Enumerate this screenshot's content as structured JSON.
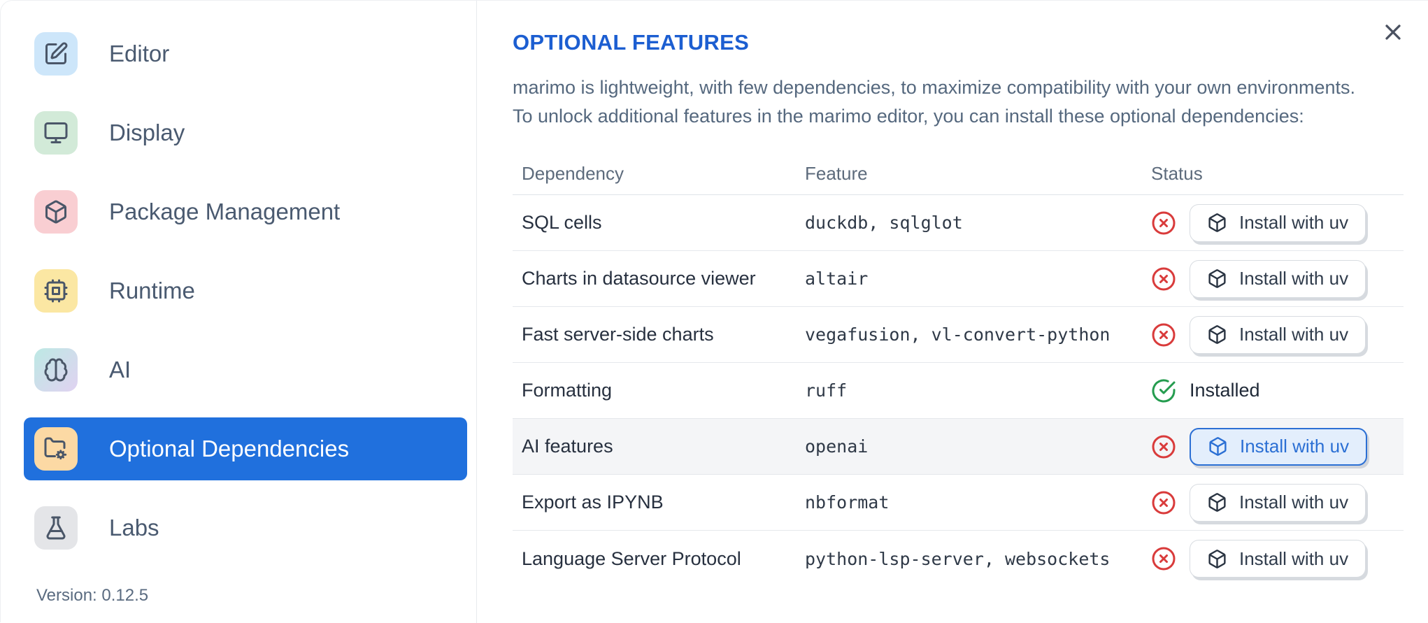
{
  "app": {
    "close_icon": "x-icon"
  },
  "sidebar": {
    "items": [
      {
        "label": "Editor",
        "icon": "edit-icon",
        "icon_bg": "#cde6fa",
        "selected": false
      },
      {
        "label": "Display",
        "icon": "monitor-icon",
        "icon_bg": "#d2ead8",
        "selected": false
      },
      {
        "label": "Package Management",
        "icon": "package-icon",
        "icon_bg": "#f9ced2",
        "selected": false
      },
      {
        "label": "Runtime",
        "icon": "cpu-icon",
        "icon_bg": "#fbe7a3",
        "selected": false
      },
      {
        "label": "AI",
        "icon": "brain-icon",
        "icon_bg": "linear-gradient(135deg,#bde9e4,#e0d2f1)",
        "selected": false
      },
      {
        "label": "Optional Dependencies",
        "icon": "folder-cog-icon",
        "icon_bg": "#fcd9a4",
        "selected": true
      },
      {
        "label": "Labs",
        "icon": "flask-icon",
        "icon_bg": "#e4e5e8",
        "selected": false
      }
    ],
    "version_label": "Version: 0.12.5"
  },
  "main": {
    "title": "OPTIONAL FEATURES",
    "description_line1": "marimo is lightweight, with few dependencies, to maximize compatibility with your own environments.",
    "description_line2": "To unlock additional features in the marimo editor, you can install these optional dependencies:",
    "table": {
      "columns": [
        "Dependency",
        "Feature",
        "Status"
      ],
      "rows": [
        {
          "dependency": "SQL cells",
          "feature": "duckdb, sqlglot",
          "installed": false,
          "action": "Install with uv",
          "highlighted": false,
          "focused": false
        },
        {
          "dependency": "Charts in datasource viewer",
          "feature": "altair",
          "installed": false,
          "action": "Install with uv",
          "highlighted": false,
          "focused": false
        },
        {
          "dependency": "Fast server-side charts",
          "feature": "vegafusion, vl-convert-python",
          "installed": false,
          "action": "Install with uv",
          "highlighted": false,
          "focused": false
        },
        {
          "dependency": "Formatting",
          "feature": "ruff",
          "installed": true,
          "status_label": "Installed",
          "highlighted": false,
          "focused": false
        },
        {
          "dependency": "AI features",
          "feature": "openai",
          "installed": false,
          "action": "Install with uv",
          "highlighted": true,
          "focused": true
        },
        {
          "dependency": "Export as IPYNB",
          "feature": "nbformat",
          "installed": false,
          "action": "Install with uv",
          "highlighted": false,
          "focused": false
        },
        {
          "dependency": "Language Server Protocol",
          "feature": "python-lsp-server, websockets",
          "installed": false,
          "action": "Install with uv",
          "highlighted": false,
          "focused": false
        }
      ]
    }
  },
  "colors": {
    "title_blue": "#1c5ed1",
    "selected_item_blue": "#2070dd",
    "status_error_red": "#d93b3b",
    "status_ok_green": "#259c4f",
    "focused_button_blue": "#2b6fd4"
  }
}
